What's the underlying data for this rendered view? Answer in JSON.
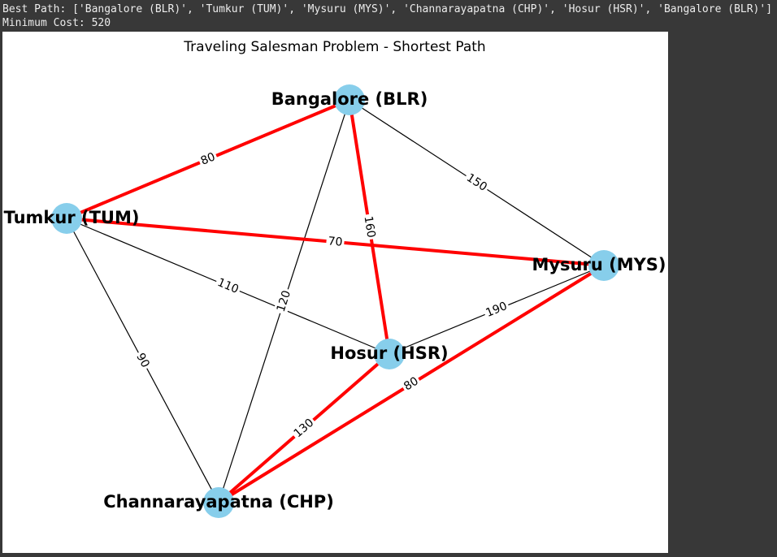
{
  "output": {
    "best_path_line": "Best Path: ['Bangalore (BLR)', 'Tumkur (TUM)', 'Mysuru (MYS)', 'Channarayapatna (CHP)', 'Hosur (HSR)', 'Bangalore (BLR)']",
    "min_cost_line": "Minimum Cost: 520"
  },
  "chart_data": {
    "type": "network",
    "title": "Traveling Salesman Problem - Shortest Path",
    "nodes": [
      {
        "id": "BLR",
        "label": "Bangalore (BLR)"
      },
      {
        "id": "TUM",
        "label": "Tumkur (TUM)"
      },
      {
        "id": "MYS",
        "label": "Mysuru (MYS)"
      },
      {
        "id": "HSR",
        "label": "Hosur (HSR)"
      },
      {
        "id": "CHP",
        "label": "Channarayapatna (CHP)"
      }
    ],
    "edges": [
      {
        "source": "BLR",
        "target": "TUM",
        "weight": 80,
        "in_path": true
      },
      {
        "source": "BLR",
        "target": "MYS",
        "weight": 150,
        "in_path": false
      },
      {
        "source": "BLR",
        "target": "HSR",
        "weight": 160,
        "in_path": true
      },
      {
        "source": "BLR",
        "target": "CHP",
        "weight": 120,
        "in_path": false
      },
      {
        "source": "TUM",
        "target": "MYS",
        "weight": 70,
        "in_path": true
      },
      {
        "source": "TUM",
        "target": "HSR",
        "weight": 110,
        "in_path": false
      },
      {
        "source": "TUM",
        "target": "CHP",
        "weight": 90,
        "in_path": false
      },
      {
        "source": "MYS",
        "target": "HSR",
        "weight": 190,
        "in_path": false
      },
      {
        "source": "MYS",
        "target": "CHP",
        "weight": 80,
        "in_path": true
      },
      {
        "source": "HSR",
        "target": "CHP",
        "weight": 130,
        "in_path": true
      }
    ],
    "colors": {
      "node": "#87ceeb",
      "path_edge": "#ff0000",
      "edge": "#000000"
    }
  }
}
